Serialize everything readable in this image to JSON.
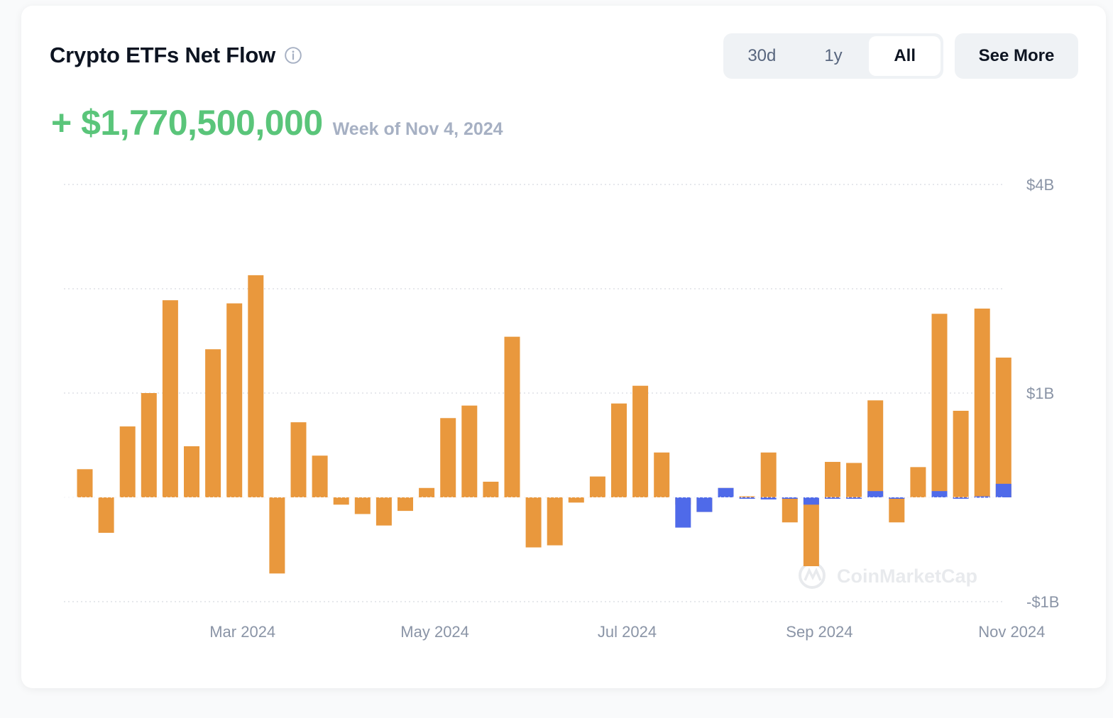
{
  "widget": {
    "title": "Crypto ETFs Net Flow",
    "headline_value": "+ $1,770,500,000",
    "headline_week": "Week of Nov 4, 2024",
    "range_options": [
      "30d",
      "1y",
      "All"
    ],
    "range_selected": "All",
    "see_more_label": "See More",
    "watermark": "CoinMarketCap",
    "colors": {
      "positive": "#5ac57a",
      "btc": "#e9983d",
      "eth": "#4f6ae9",
      "grid": "#d6dae1",
      "axis_text": "#8a94a6"
    },
    "icons": {
      "info": "info-circle-icon"
    }
  },
  "chart_data": {
    "type": "bar",
    "stacked": true,
    "y_tick_labels": [
      "$4B",
      "$1B",
      "-$1B"
    ],
    "x_tick_labels": [
      "Mar 2024",
      "May 2024",
      "Jul 2024",
      "Sep 2024",
      "Nov 2024"
    ],
    "x_tick_weeks": [
      "2024-02-26",
      "2024-04-29",
      "2024-07-01",
      "2024-09-02",
      "2024-11-04"
    ],
    "ylim": [
      -1,
      4
    ],
    "y_unit": "billion USD",
    "grid": true,
    "legend": "none",
    "x": [
      "2024-01-08",
      "2024-01-15",
      "2024-01-22",
      "2024-01-29",
      "2024-02-05",
      "2024-02-12",
      "2024-02-19",
      "2024-02-26",
      "2024-03-04",
      "2024-03-11",
      "2024-03-18",
      "2024-03-25",
      "2024-04-01",
      "2024-04-08",
      "2024-04-15",
      "2024-04-22",
      "2024-04-29",
      "2024-05-06",
      "2024-05-13",
      "2024-05-20",
      "2024-05-27",
      "2024-06-03",
      "2024-06-10",
      "2024-06-17",
      "2024-06-24",
      "2024-07-01",
      "2024-07-08",
      "2024-07-15",
      "2024-07-22",
      "2024-07-29",
      "2024-08-05",
      "2024-08-12",
      "2024-08-19",
      "2024-08-26",
      "2024-09-02",
      "2024-09-09",
      "2024-09-16",
      "2024-09-23",
      "2024-09-30",
      "2024-10-07",
      "2024-10-14",
      "2024-10-21",
      "2024-10-28",
      "2024-11-04"
    ],
    "series": [
      {
        "values": [
          0.27,
          -0.34,
          0.68,
          1.0,
          1.89,
          0.49,
          1.42,
          1.86,
          2.13,
          -0.73,
          0.72,
          0.4,
          -0.07,
          -0.16,
          -0.27,
          -0.13,
          0.09,
          0.76,
          0.88,
          0.15,
          1.54,
          -0.48,
          -0.46,
          -0.05,
          0.2,
          0.9,
          1.07,
          0.43,
          -0.07,
          -0.14,
          0.09,
          0.01,
          0.43,
          -0.24,
          -0.66,
          0.34,
          0.33,
          0.93,
          -0.24,
          0.29,
          1.76,
          0.83,
          1.81,
          1.34
        ]
      },
      {
        "values": [
          0,
          0,
          0,
          0,
          0,
          0,
          0,
          0,
          0,
          0,
          0,
          0,
          0,
          0,
          0,
          0,
          0,
          0,
          0,
          0,
          0,
          0,
          0,
          0,
          0,
          0,
          0,
          0,
          -0.29,
          -0.14,
          0.09,
          -0.01,
          -0.02,
          -0.01,
          -0.07,
          -0.01,
          -0.01,
          0.06,
          -0.01,
          0,
          0.06,
          -0.01,
          0.01,
          0.13
        ]
      }
    ]
  }
}
